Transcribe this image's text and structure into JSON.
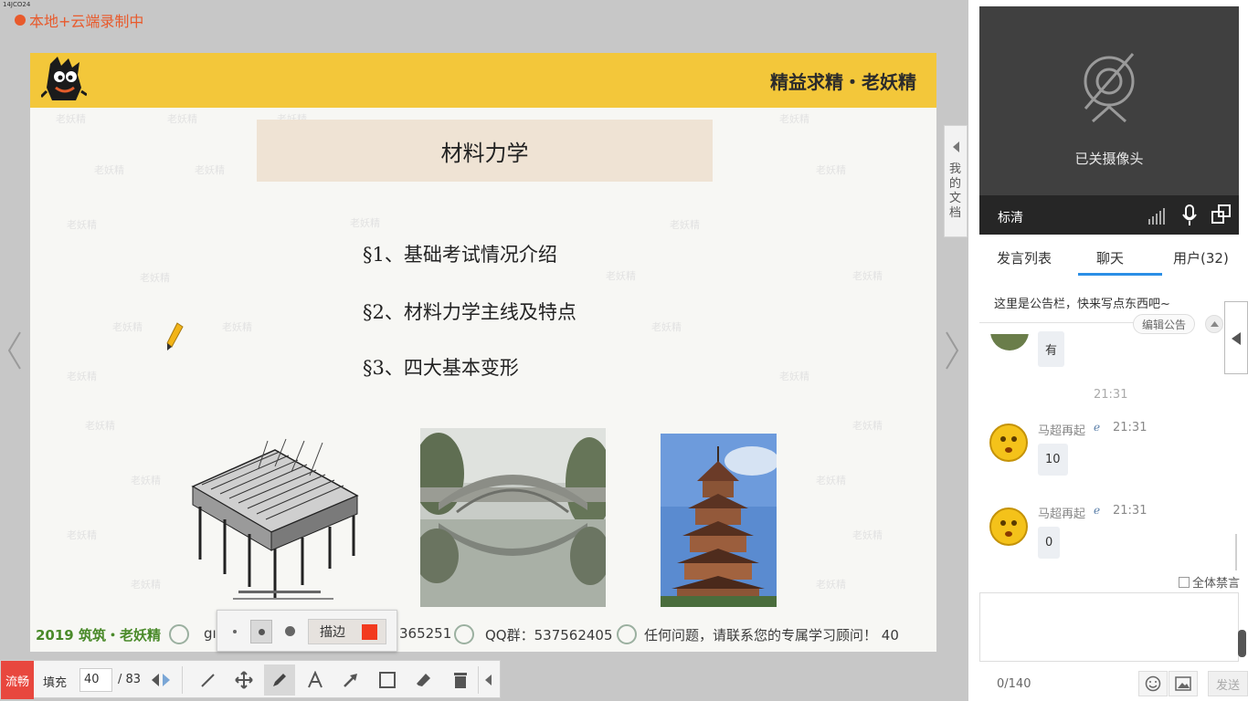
{
  "recording": {
    "tag": "14JCO24",
    "label": "本地+云端录制中"
  },
  "slide": {
    "brand": "精益求精・老妖精",
    "title": "材料力学",
    "outline": [
      "§1、基础考试情况介绍",
      "§2、材料力学主线及特点",
      "§3、四大基本变形"
    ],
    "watermark": "老妖精",
    "footer": {
      "year_brand": "2019 筑筑・老妖精",
      "site_prefix": "gı",
      "number_tail": "365251",
      "qq": "QQ群：537562405",
      "message": "任何问题，请联系您的专属学习顾问！",
      "page_no": "40"
    }
  },
  "stroke_popup": {
    "stroke_label": "描边",
    "stroke_color": "#f23a1e"
  },
  "toolbar": {
    "mode_label": "流畅",
    "fill_label": "填充",
    "current_page": "40",
    "total_pages": "/ 83",
    "accent_color": "#e8473e"
  },
  "docs_tab": {
    "label": "我的文档"
  },
  "video": {
    "camera_status": "已关摄像头",
    "quality": "标清"
  },
  "tabs": [
    "发言列表",
    "聊天",
    "用户(32)"
  ],
  "notice": {
    "text": "这里是公告栏，快来写点东西吧~",
    "edit_label": "编辑公告"
  },
  "chat": {
    "partial_message": "有",
    "timestamp": "21:31",
    "messages": [
      {
        "user": "马超再起",
        "time": "21:31",
        "text": "10"
      },
      {
        "user": "马超再起",
        "time": "21:31",
        "text": "0"
      }
    ]
  },
  "mute_all_label": "全体禁言",
  "char_count": "0/140",
  "send_label": "发送"
}
